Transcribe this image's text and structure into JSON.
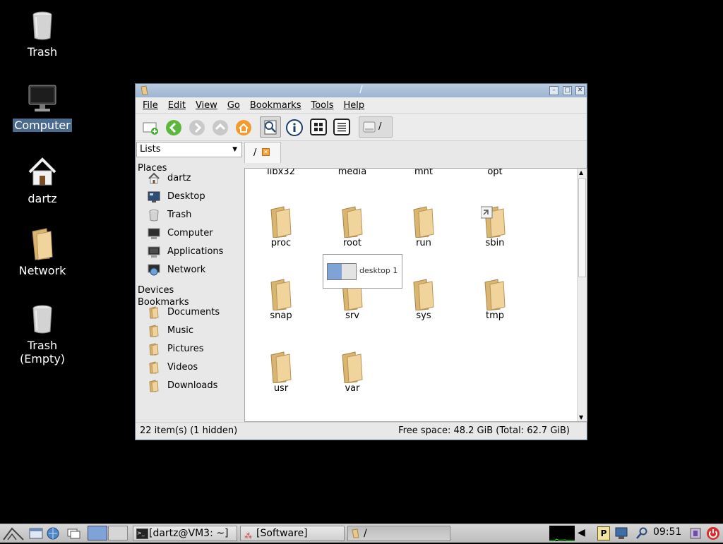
{
  "desktop": {
    "icons": [
      {
        "label": "Trash",
        "icon": "trash-can-icon"
      },
      {
        "label": "Computer",
        "icon": "monitor-icon",
        "selected": true
      },
      {
        "label": "dartz",
        "icon": "home-icon"
      },
      {
        "label": "Network",
        "icon": "network-folder-icon"
      },
      {
        "label": "Trash\n(Empty)",
        "label_line1": "Trash",
        "label_line2": "(Empty)",
        "icon": "trash-can-icon"
      }
    ]
  },
  "window": {
    "title": "/",
    "menu": [
      "File",
      "Edit",
      "View",
      "Go",
      "Bookmarks",
      "Tools",
      "Help"
    ],
    "path_label": "/",
    "side_pane_mode": "Lists",
    "tab_label": "/",
    "sidebar": {
      "places_header": "Places",
      "places": [
        "dartz",
        "Desktop",
        "Trash",
        "Computer",
        "Applications",
        "Network"
      ],
      "devices_header": "Devices",
      "bookmarks_header": "Bookmarks",
      "bookmarks": [
        "Documents",
        "Music",
        "Pictures",
        "Videos",
        "Downloads"
      ]
    },
    "files_partial_row": [
      "libx32",
      "media",
      "mnt",
      "opt"
    ],
    "files": [
      "proc",
      "root",
      "run",
      "sbin",
      "snap",
      "srv",
      "sys",
      "tmp",
      "usr",
      "var"
    ],
    "tooltip": "desktop 1",
    "status_left": "22 item(s) (1 hidden)",
    "status_right": "Free space: 48.2 GiB (Total: 62.7 GiB)"
  },
  "taskbar": {
    "tasks": [
      "[dartz@VM3: ~]",
      "[Software]",
      "/"
    ],
    "clock": "09:51",
    "pager_label": "P"
  },
  "colors": {
    "desktop_bg": "#000000",
    "titlebar": "#a9bed8",
    "folder": "#e9c98a",
    "selection": "#4a6b8e"
  }
}
